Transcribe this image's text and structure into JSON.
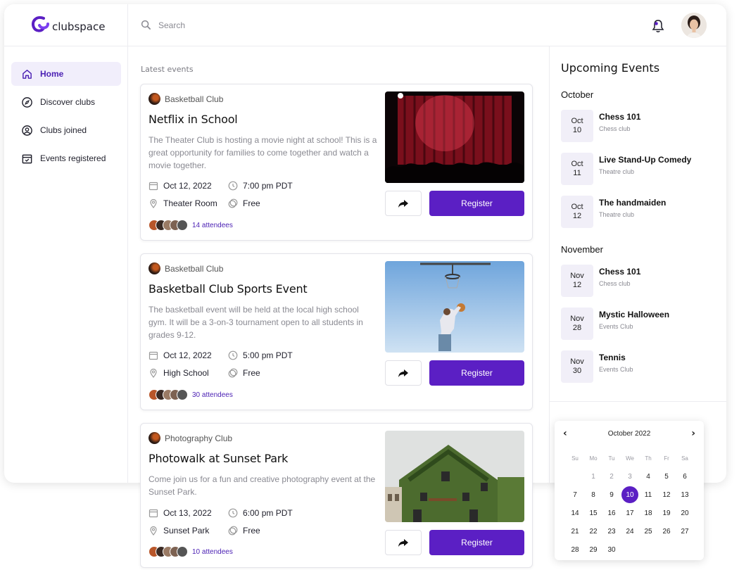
{
  "app": {
    "logo_text": "clubspace"
  },
  "search": {
    "placeholder": "Search"
  },
  "sidebar": {
    "items": [
      {
        "label": "Home",
        "icon": "home-icon",
        "active": true
      },
      {
        "label": "Discover clubs",
        "icon": "compass-icon"
      },
      {
        "label": "Clubs joined",
        "icon": "user-circle-icon"
      },
      {
        "label": "Events registered",
        "icon": "calendar-check-icon"
      }
    ]
  },
  "main": {
    "section_label": "Latest events",
    "events": [
      {
        "club": "Basketball Club",
        "title": "Netflix in School",
        "description": "The Theater Club is hosting a movie night at school! This is a great opportunity for families to come together and watch a movie together.",
        "date": "Oct 12, 2022",
        "time": "7:00 pm PDT",
        "location": "Theater Room",
        "price": "Free",
        "attendees": "14 attendees",
        "register_label": "Register",
        "image": "theater-stage"
      },
      {
        "club": "Basketball Club",
        "title": "Basketball Club Sports Event",
        "description": "The basketball event will be held at the local high school gym. It will be a 3-on-3 tournament open to all students in grades 9-12.",
        "date": "Oct 12, 2022",
        "time": "5:00 pm PDT",
        "location": "High School",
        "price": "Free",
        "attendees": "30 attendees",
        "register_label": "Register",
        "image": "basketball-dunk"
      },
      {
        "club": "Photography Club",
        "title": "Photowalk at Sunset Park",
        "description": "Come join us for a fun and creative photography event at the Sunset Park.",
        "date": "Oct 13, 2022",
        "time": "6:00 pm PDT",
        "location": "Sunset Park",
        "price": "Free",
        "attendees": "10 attendees",
        "register_label": "Register",
        "image": "ivy-house"
      }
    ]
  },
  "upcoming": {
    "title": "Upcoming Events",
    "months": [
      {
        "name": "October",
        "items": [
          {
            "mon": "Oct",
            "day": "10",
            "name": "Chess 101",
            "club": "Chess club"
          },
          {
            "mon": "Oct",
            "day": "11",
            "name": "Live Stand-Up Comedy",
            "club": "Theatre club"
          },
          {
            "mon": "Oct",
            "day": "12",
            "name": "The handmaiden",
            "club": "Theatre club"
          }
        ]
      },
      {
        "name": "November",
        "items": [
          {
            "mon": "Nov",
            "day": "12",
            "name": "Chess 101",
            "club": "Chess club"
          },
          {
            "mon": "Nov",
            "day": "28",
            "name": "Mystic Halloween",
            "club": "Events Club"
          },
          {
            "mon": "Nov",
            "day": "30",
            "name": "Tennis",
            "club": "Events Club"
          }
        ]
      }
    ]
  },
  "calendar": {
    "title": "October 2022",
    "prev": "‹",
    "next": "›",
    "weekdays": [
      "Su",
      "Mo",
      "Tu",
      "We",
      "Th",
      "Fr",
      "Sa"
    ],
    "leading_blank": 1,
    "muted_days": [
      "1",
      "2",
      "3"
    ],
    "selected": "10",
    "days": [
      "1",
      "2",
      "3",
      "4",
      "5",
      "6",
      "7",
      "8",
      "9",
      "10",
      "11",
      "12",
      "13",
      "14",
      "15",
      "16",
      "17",
      "18",
      "19",
      "20",
      "21",
      "22",
      "23",
      "24",
      "25",
      "26",
      "27",
      "28",
      "29",
      "30"
    ]
  },
  "colors": {
    "accent": "#5b1fc4",
    "active_bg": "#f1eefb"
  }
}
